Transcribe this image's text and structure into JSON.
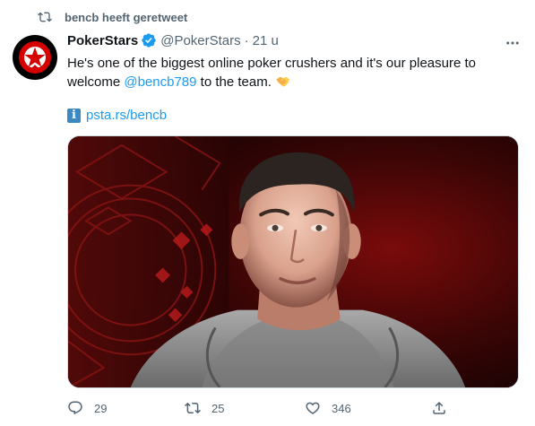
{
  "retweet": {
    "label": "bencb heeft geretweet"
  },
  "tweet": {
    "author_name": "PokerStars",
    "handle": "@PokerStars",
    "separator": "·",
    "time": "21 u",
    "text_before": "He's one of the biggest online poker crushers and it's our pleasure to welcome ",
    "mention": "@bencb789",
    "text_after": " to the team.",
    "link": "psta.rs/bencb"
  },
  "stats": {
    "replies": "29",
    "retweets": "25",
    "likes": "346"
  },
  "icons": {
    "retweet": "retweet-icon",
    "verified": "verified-badge-icon",
    "more": "more-options-icon",
    "info": "information-icon",
    "emoji": "handshake-emoji",
    "reply": "reply-icon",
    "like": "heart-icon",
    "share": "share-icon"
  },
  "colors": {
    "accent": "#1d9bf0",
    "muted": "#536471",
    "text": "#0f1419"
  }
}
